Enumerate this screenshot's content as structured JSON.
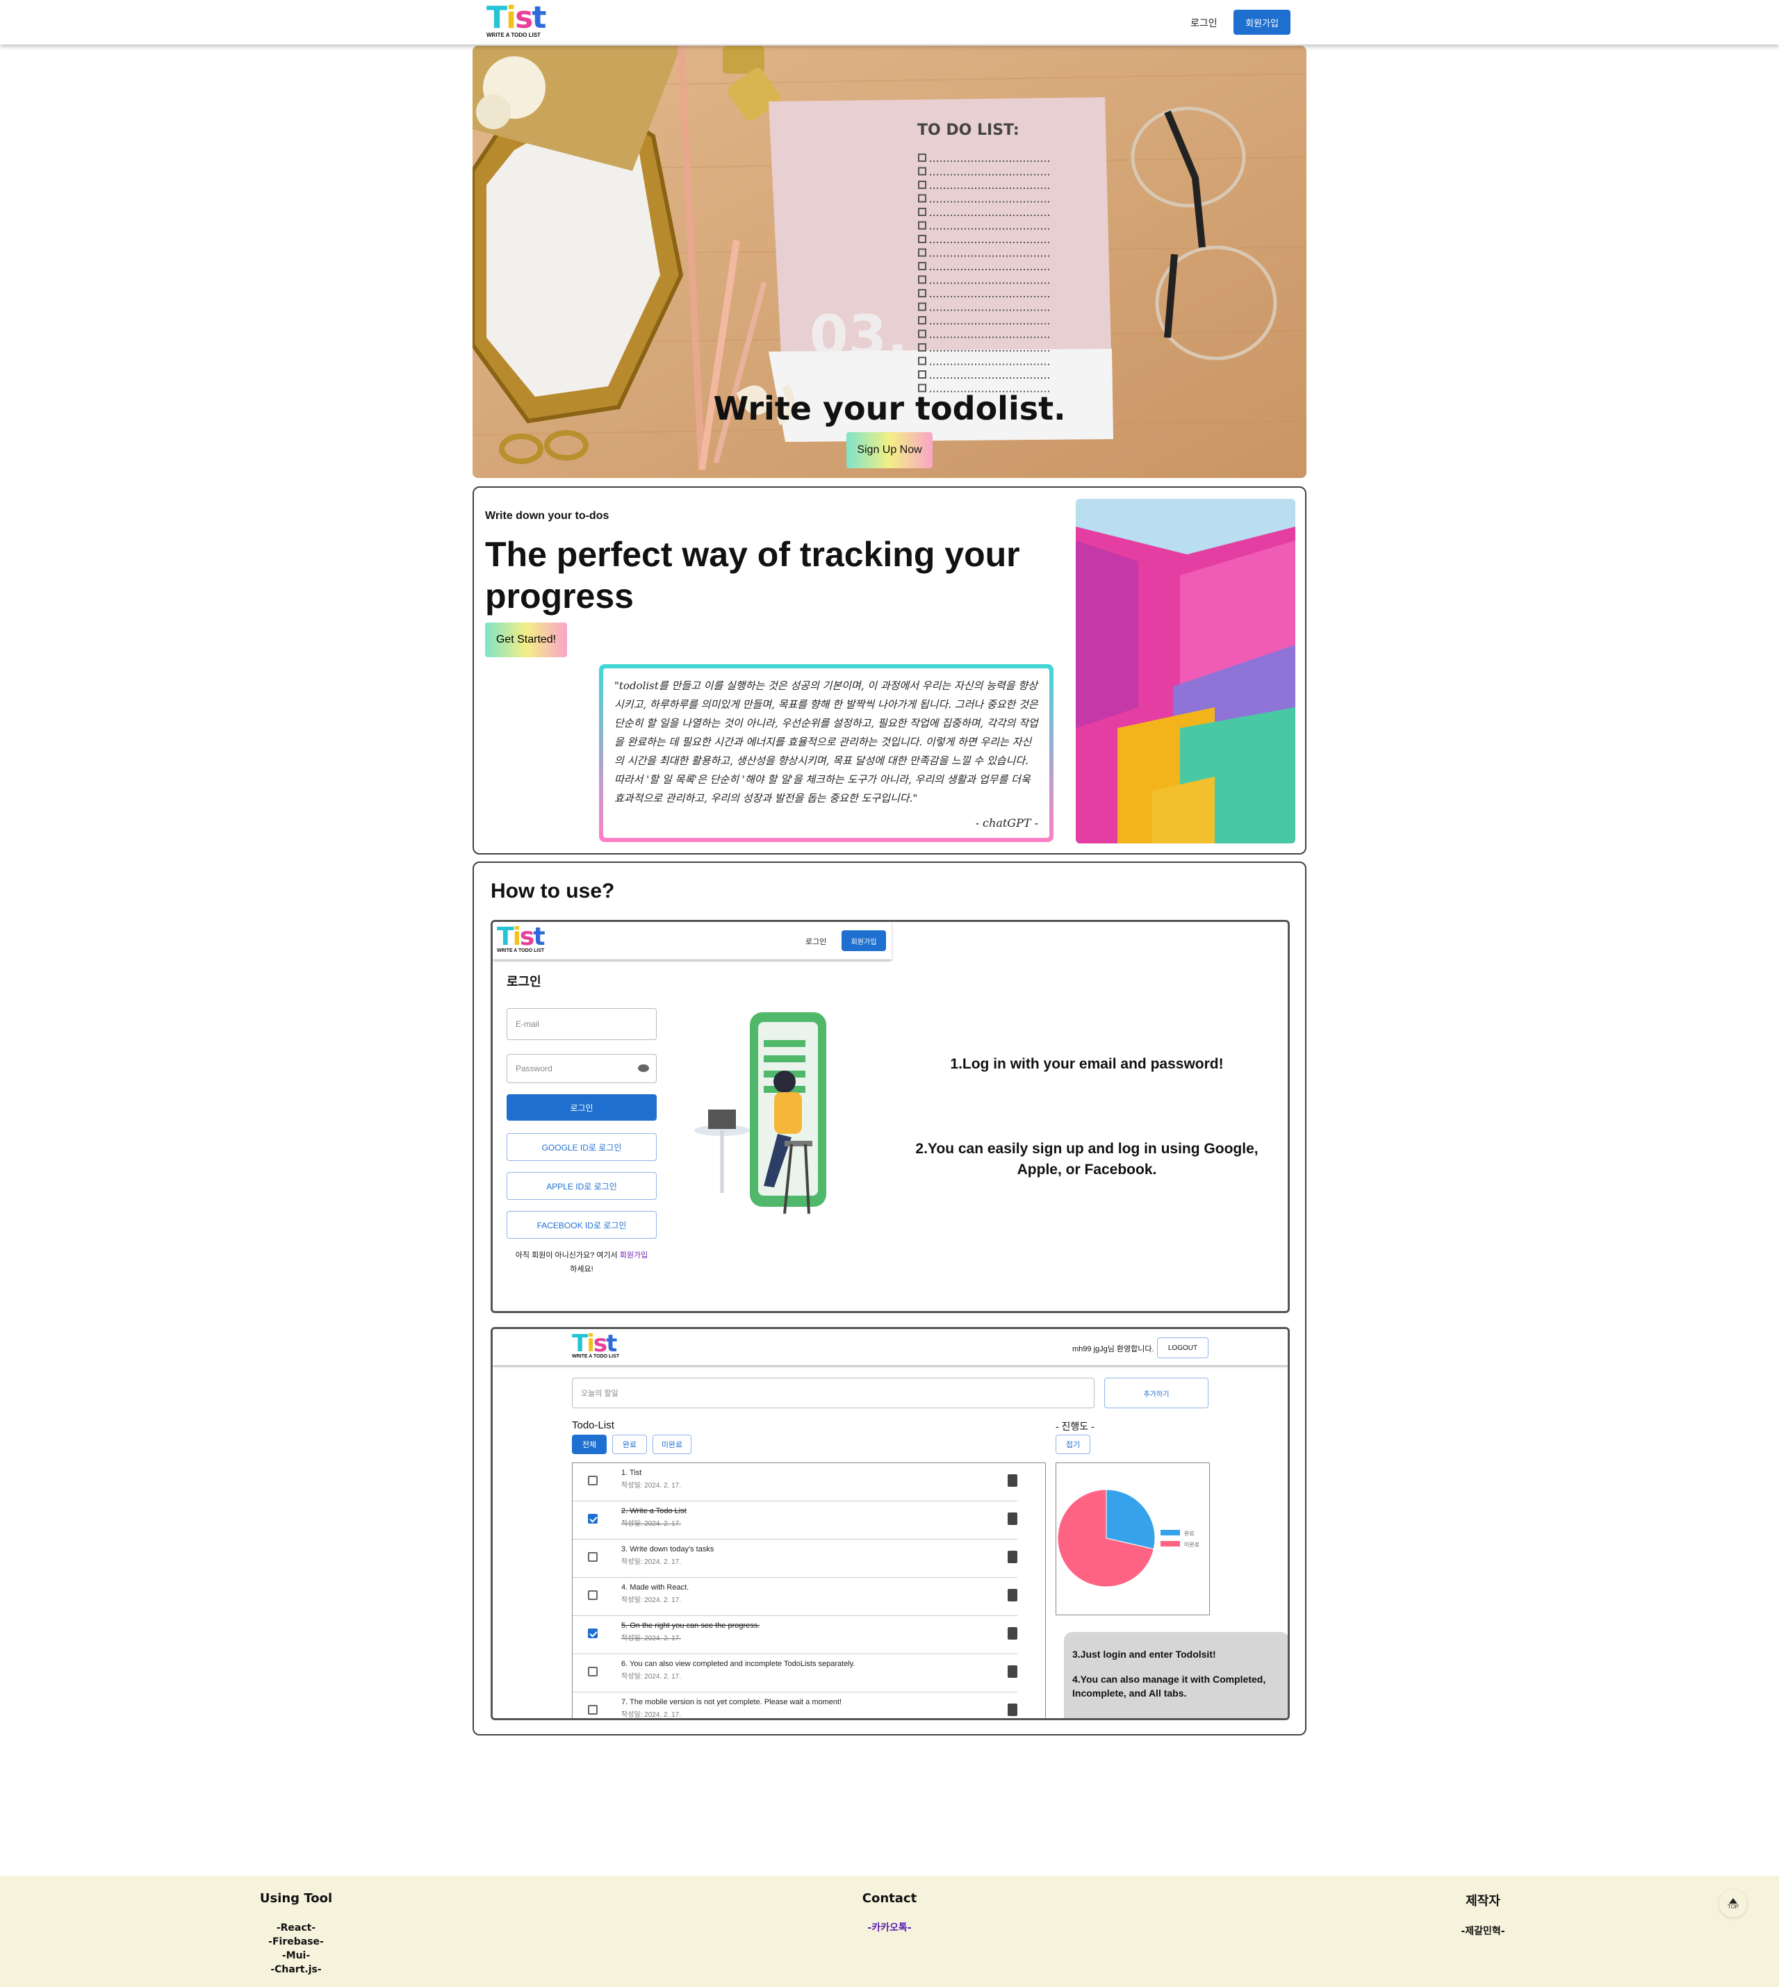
{
  "nav": {
    "logo_text": "Tist",
    "logo_sub": "WRITE A TODO LIST",
    "login": "로그인",
    "signup": "회원가입"
  },
  "hero": {
    "title": "Write your todolist.",
    "button": "Sign Up Now",
    "paper_heading": "TO DO LIST:",
    "paper_number": "03."
  },
  "intro": {
    "eyebrow": "Write down your to-dos",
    "heading": "The perfect way of tracking your progress",
    "button": "Get Started!",
    "quote": "\"todolist를 만들고 이를 실행하는 것은 성공의 기본이며, 이 과정에서 우리는 자신의 능력을 향상시키고, 하루하루를 의미있게 만들며, 목표를 향해 한 발짝씩 나아가게 됩니다. 그러나 중요한 것은 단순히 할 일을 나열하는 것이 아니라, 우선순위를 설정하고, 필요한 작업에 집중하며, 각각의 작업을 완료하는 데 필요한 시간과 에너지를 효율적으로 관리하는 것입니다. 이렇게 하면 우리는 자신의 시간을 최대한 활용하고, 생산성을 향상시키며, 목표 달성에 대한 만족감을 느낄 수 있습니다. 따라서 '할 일 목록'은 단순히 '해야 할 일'을 체크하는 도구가 아니라, 우리의 생활과 업무를 더욱 효과적으로 관리하고, 우리의 성장과 발전을 돕는 중요한 도구입니다.\"",
    "cite": "- chatGPT -"
  },
  "howto": {
    "title": "How to use?",
    "shot1": {
      "login_nav": "로그인",
      "signup_nav": "회원가입",
      "page_title": "로그인",
      "email_placeholder": "E-mail",
      "password_placeholder": "Password",
      "login_button": "로그인",
      "google_button": "GOOGLE ID로 로그인",
      "apple_button": "APPLE ID로 로그인",
      "facebook_button": "FACEBOOK ID로 로그인",
      "signup_prompt_1": "아직 회원이 아니신가요? 여기서 ",
      "signup_prompt_link": "회원가입",
      "signup_prompt_2": "하세요!",
      "step1": "1.Log in with your email and password!",
      "step2": "2.You can easily sign up and log in using Google, Apple, or Facebook."
    },
    "shot2": {
      "greeting": "mh99 jgJg님 환영합니다.",
      "logout": "LOGOUT",
      "todo_placeholder": "오늘의 할일",
      "add_button": "추가하기",
      "list_title": "Todo-List",
      "tabs": [
        "전체",
        "완료",
        "미완료"
      ],
      "progress_title": "- 진행도 -",
      "collapse_button": "접기",
      "legend": [
        "완료",
        "미완료"
      ],
      "todos": [
        {
          "text": "1. Tist",
          "date": "작성일: 2024. 2. 17.",
          "done": false
        },
        {
          "text": "2. Write a Todo List",
          "date": "작성일: 2024. 2. 17.",
          "done": true
        },
        {
          "text": "3. Write down today's tasks",
          "date": "작성일: 2024. 2. 17.",
          "done": false
        },
        {
          "text": "4. Made with React.",
          "date": "작성일: 2024. 2. 17.",
          "done": false
        },
        {
          "text": "5. On the right you can see the progress.",
          "date": "작성일: 2024. 2. 17.",
          "done": true
        },
        {
          "text": "6. You can also view completed and incomplete TodoLists separately.",
          "date": "작성일: 2024. 2. 17.",
          "done": false
        },
        {
          "text": "7. The mobile version is not yet complete. Please wait a moment!",
          "date": "작성일: 2024. 2. 17.",
          "done": false
        }
      ],
      "step3": "3.Just login and enter Todolsit!",
      "step4": "4.You can also manage it with Completed, Incomplete, and All tabs."
    }
  },
  "chart_data": {
    "type": "pie",
    "categories": [
      "완료",
      "미완료"
    ],
    "values": [
      2,
      5
    ],
    "colors": [
      "#36a2eb",
      "#ff6384"
    ]
  },
  "footer": {
    "col1_title": "Using Tool",
    "col1_items": [
      "-React-",
      "-Firebase-",
      "-Mui-",
      "-Chart.js-"
    ],
    "col2_title": "Contact",
    "col2_link": "-카카오톡-",
    "col3_title": "제작자",
    "col3_item": "-제갈민혁-",
    "top_label": "TOP"
  },
  "colors": {
    "primary": "#1e6fd0",
    "footer_bg": "#f5f3dc",
    "gradient": [
      "#7fe3c8",
      "#f3ef86",
      "#f8a5c8"
    ]
  }
}
